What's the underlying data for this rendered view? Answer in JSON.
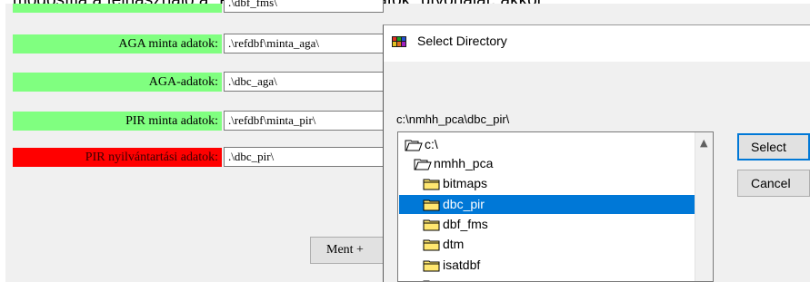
{
  "caption": "módosítja a felhasználó a „PIR nyilvántartási adatok” útvonalat, akkor",
  "form": {
    "rows": [
      {
        "label": "",
        "value": ".\\dbf_fms\\"
      },
      {
        "label": "AGA minta adatok:",
        "value": ".\\refdbf\\minta_aga\\"
      },
      {
        "label": "AGA-adatok:",
        "value": ".\\dbc_aga\\"
      },
      {
        "label": "PIR minta adatok:",
        "value": ".\\refdbf\\minta_pir\\"
      },
      {
        "label": "PIR nyilvántartási adatok:",
        "value": ".\\dbc_pir\\"
      }
    ],
    "label_colors": {
      "green": "#80ff80",
      "red": "#ff0000"
    },
    "save_button": "Ment +"
  },
  "dialog": {
    "title": "Select Directory",
    "current_path": "c:\\nmhh_pca\\dbc_pir\\",
    "tree": [
      {
        "label": "c:\\",
        "icon": "open-folder-icon",
        "selected": false
      },
      {
        "label": "nmhh_pca",
        "icon": "open-folder-icon",
        "selected": false
      },
      {
        "label": "bitmaps",
        "icon": "folder-icon",
        "selected": false
      },
      {
        "label": "dbc_pir",
        "icon": "folder-icon",
        "selected": true
      },
      {
        "label": "dbf_fms",
        "icon": "folder-icon",
        "selected": false
      },
      {
        "label": "dtm",
        "icon": "folder-icon",
        "selected": false
      },
      {
        "label": "isatdbf",
        "icon": "folder-icon",
        "selected": false
      }
    ],
    "select_button": "Select",
    "cancel_button": "Cancel",
    "selection_color": "#0078d7"
  }
}
